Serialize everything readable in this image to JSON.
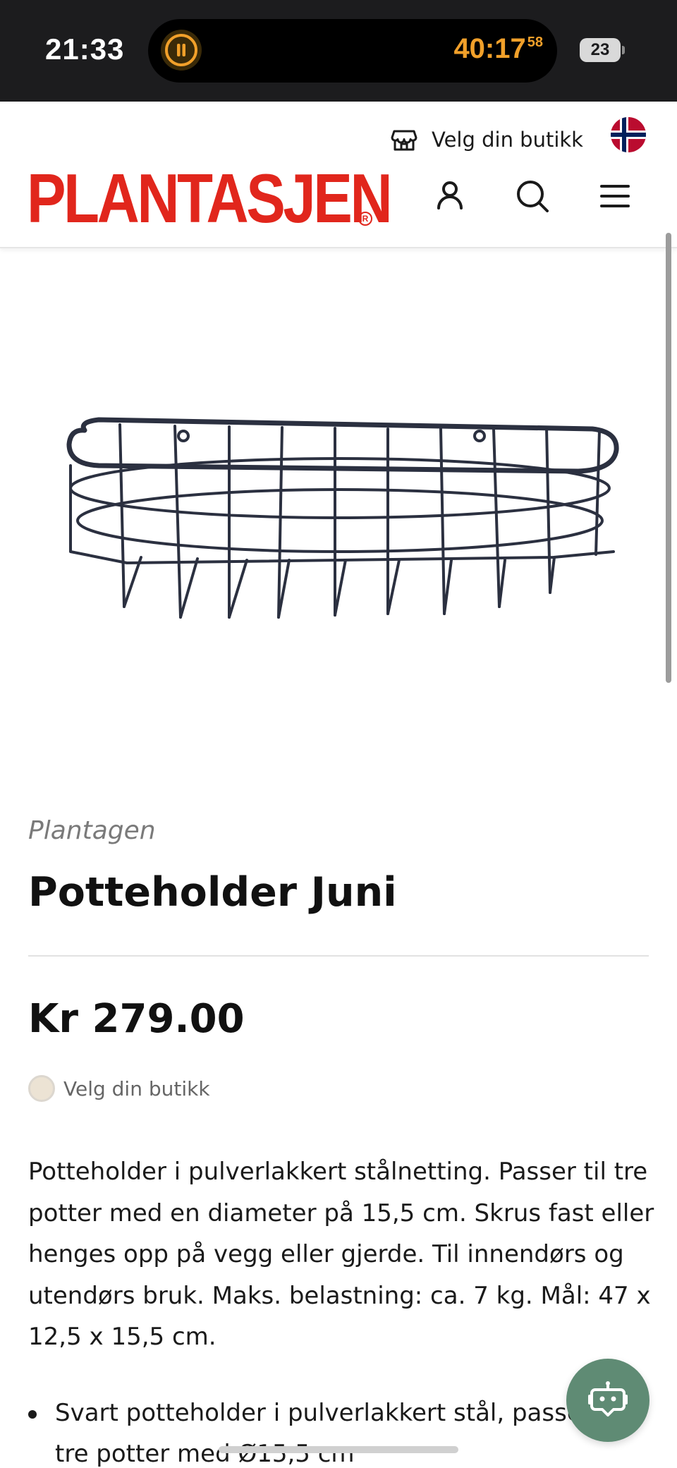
{
  "status_bar": {
    "time": "21:33",
    "timer": "40:17",
    "timer_fraction": "58",
    "battery": "23"
  },
  "header": {
    "store_picker_label": "Velg din butikk",
    "logo_text": "PLANTASJEN",
    "logo_reg": "R",
    "icons": [
      "store-icon",
      "norway-flag-icon",
      "user-icon",
      "search-icon",
      "menu-icon"
    ]
  },
  "product": {
    "image_alt_icon": "wire-basket-product-image",
    "brand": "Plantagen",
    "title": "Potteholder Juni",
    "price": "Kr 279.00",
    "store_stock_label": "Velg din butikk",
    "description": "Potteholder i pulverlakkert stålnetting. Passer til tre potter med en diameter på 15,5 cm. Skrus fast eller henges opp på vegg eller gjerde. Til innendørs og utendørs bruk. Maks. belastning: ca. 7 kg. Mål: 47 x 12,5 x 15,5 cm.",
    "bullets": [
      "Svart potteholder i pulverlakkert stål, passer tre potter med Ø15,5 cm"
    ]
  },
  "chat": {
    "icon": "chatbot-icon"
  },
  "colors": {
    "brand_red": "#e1261c",
    "timer_orange": "#f1a02a",
    "chat_green": "#5f8b74"
  }
}
